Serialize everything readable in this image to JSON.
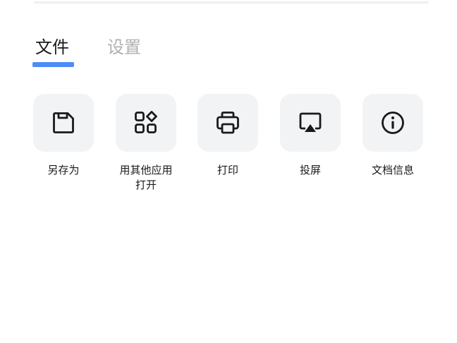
{
  "tabs": {
    "file_label": "文件",
    "settings_label": "设置",
    "active": "file"
  },
  "colors": {
    "accent": "#4c8df6",
    "tile_background": "#f2f3f5",
    "text_primary": "#1a1a1a",
    "text_inactive": "#b0b0b0"
  },
  "actions": [
    {
      "icon": "save-icon",
      "label_line1": "另存为",
      "label_line2": ""
    },
    {
      "icon": "apps-icon",
      "label_line1": "用其他应用",
      "label_line2": "打开"
    },
    {
      "icon": "printer-icon",
      "label_line1": "打印",
      "label_line2": ""
    },
    {
      "icon": "screen-cast-icon",
      "label_line1": "投屏",
      "label_line2": ""
    },
    {
      "icon": "info-icon",
      "label_line1": "文档信息",
      "label_line2": ""
    }
  ]
}
